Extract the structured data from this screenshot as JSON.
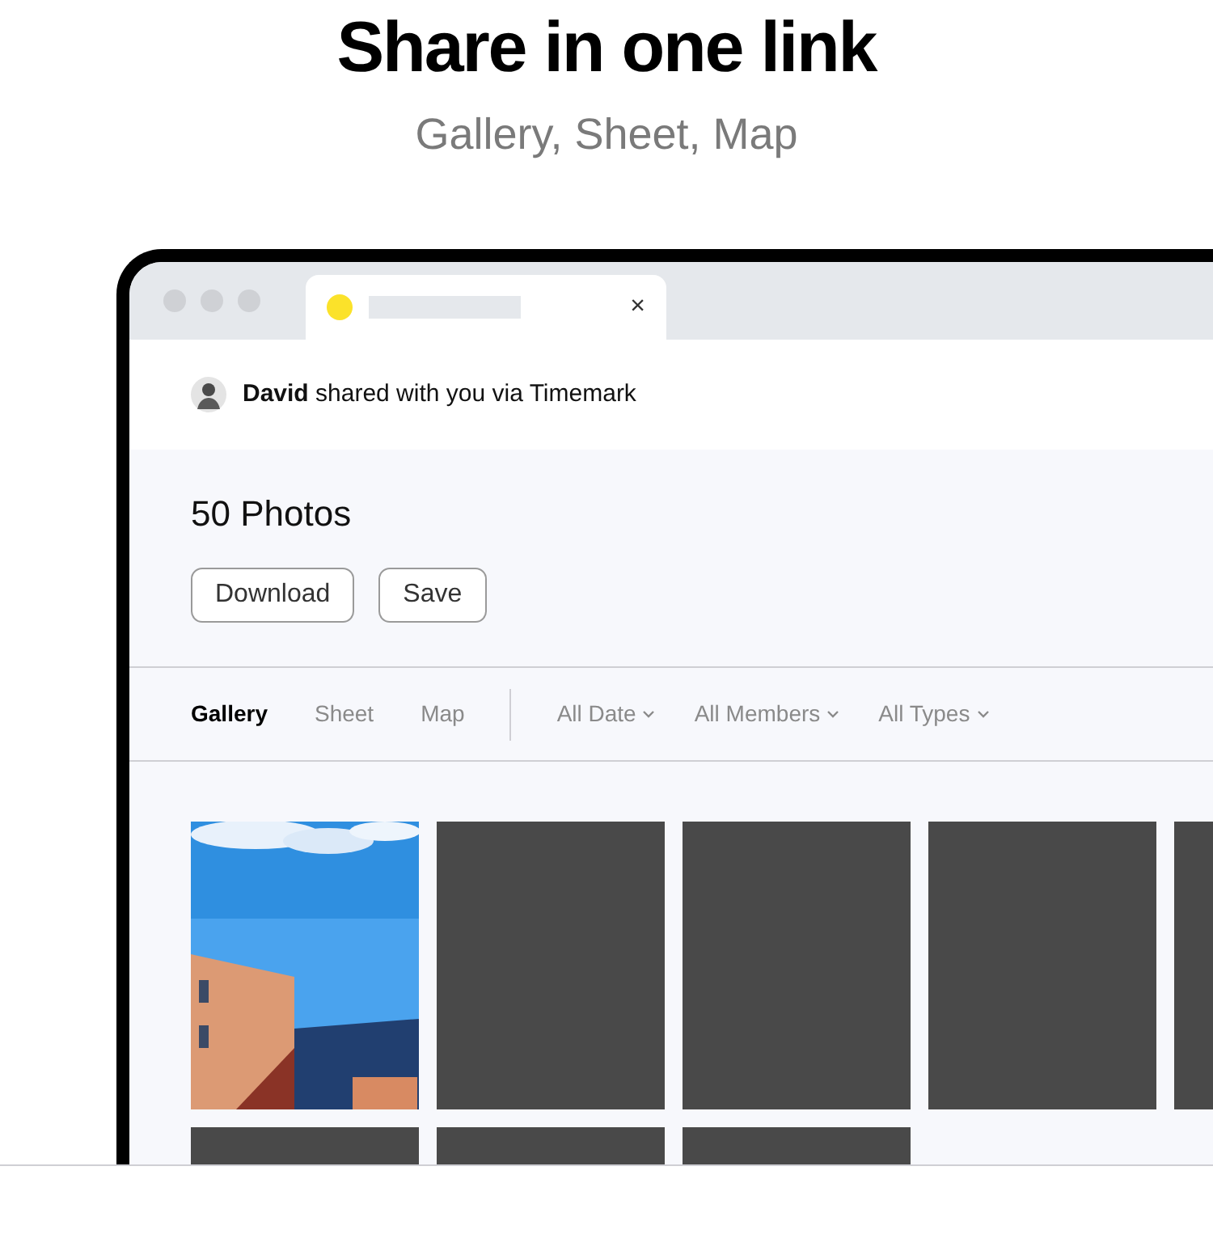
{
  "header": {
    "title": "Share in one link",
    "subtitle": "Gallery, Sheet, Map"
  },
  "browser": {
    "tab": {
      "close": "×"
    }
  },
  "share_bar": {
    "message": "**David** shared with you via Timemark"
  },
  "album": {
    "title": "50 Photos",
    "buttons": [
      "Download",
      "Save"
    ]
  },
  "views": [
    {
      "label": "Gallery",
      "selected": true
    },
    {
      "label": "Sheet",
      "selected": false
    },
    {
      "label": "Map",
      "selected": false
    }
  ],
  "filters": [
    "All Date",
    "All Members",
    "All Types"
  ],
  "photos": [
    {
      "kind": "picture"
    },
    {
      "kind": "placeholder"
    },
    {
      "kind": "placeholder"
    },
    {
      "kind": "placeholder"
    },
    {
      "kind": "placeholder"
    },
    {
      "kind": "placeholder"
    },
    {
      "kind": "placeholder"
    },
    {
      "kind": "placeholder"
    }
  ]
}
